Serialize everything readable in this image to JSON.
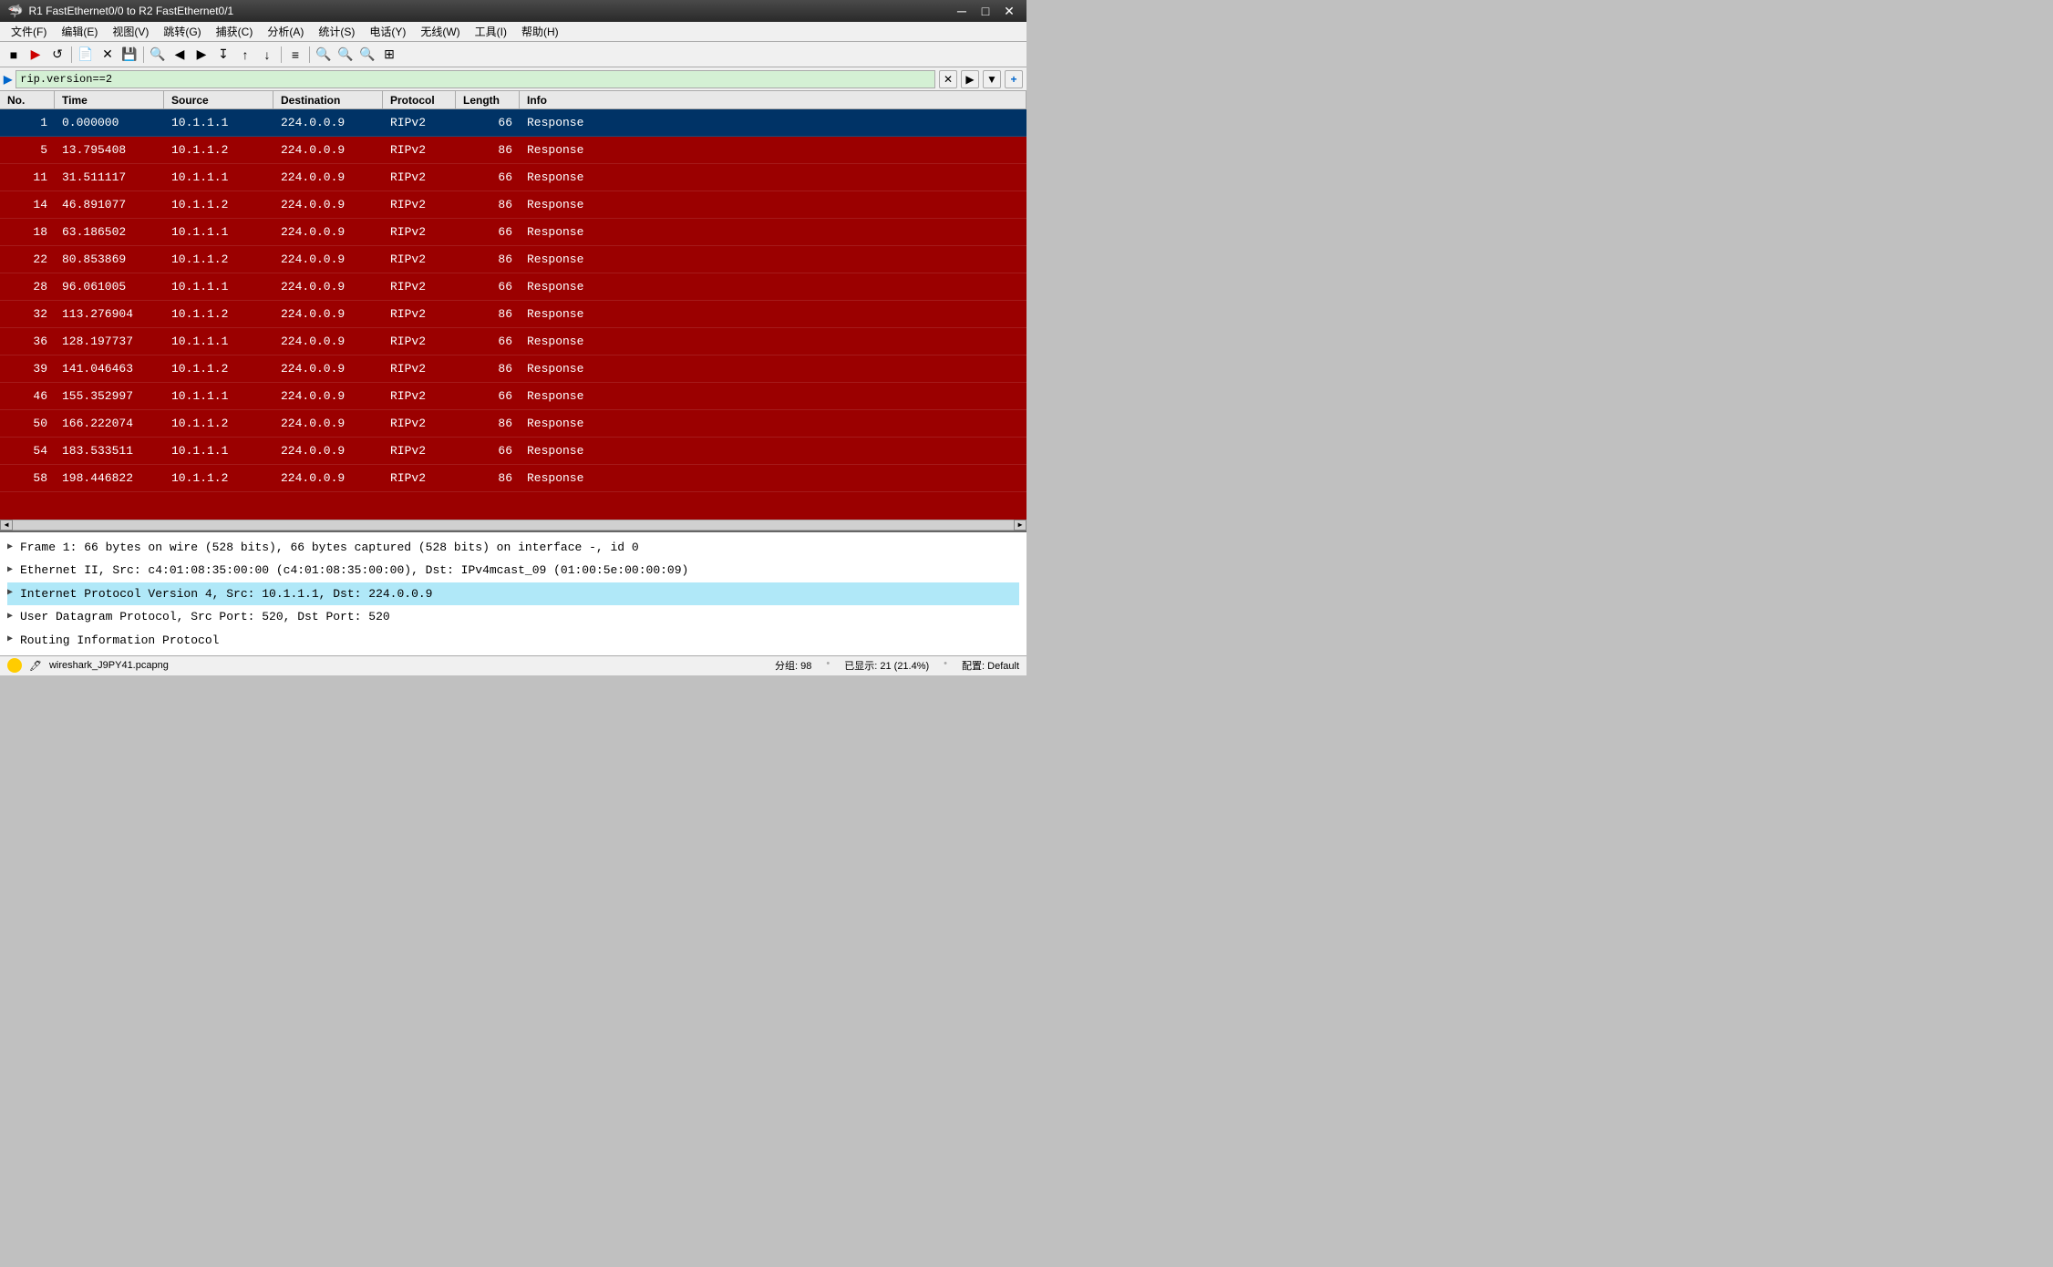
{
  "window": {
    "title": "R1 FastEthernet0/0 to R2 FastEthernet0/1",
    "icon": "🦈"
  },
  "menu": {
    "items": [
      {
        "label": "文件(F)"
      },
      {
        "label": "编辑(E)"
      },
      {
        "label": "视图(V)"
      },
      {
        "label": "跳转(G)"
      },
      {
        "label": "捕获(C)"
      },
      {
        "label": "分析(A)"
      },
      {
        "label": "统计(S)"
      },
      {
        "label": "电话(Y)"
      },
      {
        "label": "无线(W)"
      },
      {
        "label": "工具(I)"
      },
      {
        "label": "帮助(H)"
      }
    ]
  },
  "filter": {
    "value": "rip.version==2",
    "label": ""
  },
  "columns": {
    "no": "No.",
    "time": "Time",
    "source": "Source",
    "destination": "Destination",
    "protocol": "Protocol",
    "length": "Length",
    "info": "Info"
  },
  "packets": [
    {
      "no": "1",
      "time": "0.000000",
      "src": "10.1.1.1",
      "dst": "224.0.0.9",
      "proto": "RIPv2",
      "len": "66",
      "info": "Response"
    },
    {
      "no": "5",
      "time": "13.795408",
      "src": "10.1.1.2",
      "dst": "224.0.0.9",
      "proto": "RIPv2",
      "len": "86",
      "info": "Response"
    },
    {
      "no": "11",
      "time": "31.511117",
      "src": "10.1.1.1",
      "dst": "224.0.0.9",
      "proto": "RIPv2",
      "len": "66",
      "info": "Response"
    },
    {
      "no": "14",
      "time": "46.891077",
      "src": "10.1.1.2",
      "dst": "224.0.0.9",
      "proto": "RIPv2",
      "len": "86",
      "info": "Response"
    },
    {
      "no": "18",
      "time": "63.186502",
      "src": "10.1.1.1",
      "dst": "224.0.0.9",
      "proto": "RIPv2",
      "len": "66",
      "info": "Response"
    },
    {
      "no": "22",
      "time": "80.853869",
      "src": "10.1.1.2",
      "dst": "224.0.0.9",
      "proto": "RIPv2",
      "len": "86",
      "info": "Response"
    },
    {
      "no": "28",
      "time": "96.061005",
      "src": "10.1.1.1",
      "dst": "224.0.0.9",
      "proto": "RIPv2",
      "len": "66",
      "info": "Response"
    },
    {
      "no": "32",
      "time": "113.276904",
      "src": "10.1.1.2",
      "dst": "224.0.0.9",
      "proto": "RIPv2",
      "len": "86",
      "info": "Response"
    },
    {
      "no": "36",
      "time": "128.197737",
      "src": "10.1.1.1",
      "dst": "224.0.0.9",
      "proto": "RIPv2",
      "len": "66",
      "info": "Response"
    },
    {
      "no": "39",
      "time": "141.046463",
      "src": "10.1.1.2",
      "dst": "224.0.0.9",
      "proto": "RIPv2",
      "len": "86",
      "info": "Response"
    },
    {
      "no": "46",
      "time": "155.352997",
      "src": "10.1.1.1",
      "dst": "224.0.0.9",
      "proto": "RIPv2",
      "len": "66",
      "info": "Response"
    },
    {
      "no": "50",
      "time": "166.222074",
      "src": "10.1.1.2",
      "dst": "224.0.0.9",
      "proto": "RIPv2",
      "len": "86",
      "info": "Response"
    },
    {
      "no": "54",
      "time": "183.533511",
      "src": "10.1.1.1",
      "dst": "224.0.0.9",
      "proto": "RIPv2",
      "len": "66",
      "info": "Response"
    },
    {
      "no": "58",
      "time": "198.446822",
      "src": "10.1.1.2",
      "dst": "224.0.0.9",
      "proto": "RIPv2",
      "len": "86",
      "info": "Response"
    }
  ],
  "detail": {
    "rows": [
      {
        "id": "frame",
        "expanded": false,
        "text": "Frame 1: 66 bytes on wire (528 bits), 66 bytes captured (528 bits) on interface -, id 0",
        "highlighted": false
      },
      {
        "id": "ethernet",
        "expanded": false,
        "text": "Ethernet II, Src: c4:01:08:35:00:00 (c4:01:08:35:00:00), Dst: IPv4mcast_09 (01:00:5e:00:00:09)",
        "highlighted": false
      },
      {
        "id": "ip",
        "expanded": false,
        "text": "Internet Protocol Version 4, Src: 10.1.1.1, Dst: 224.0.0.9",
        "highlighted": true
      },
      {
        "id": "udp",
        "expanded": false,
        "text": "User Datagram Protocol, Src Port: 520, Dst Port: 520",
        "highlighted": false
      },
      {
        "id": "rip",
        "expanded": false,
        "text": "Routing Information Protocol",
        "highlighted": false
      }
    ]
  },
  "status": {
    "filename": "wireshark_J9PY41.pcapng",
    "groups": "分组: 98",
    "displayed": "已显示: 21 (21.4%)",
    "config": "配置: Default"
  },
  "toolbar_buttons": [
    "■",
    "▶",
    "↺",
    "⊟",
    "✕",
    "↺",
    "🔍",
    "◀",
    "▶",
    "↧",
    "↑",
    "↓",
    "≡",
    "▣",
    "🔍+",
    "🔍-",
    "🔍×",
    "⊞"
  ],
  "colors": {
    "packet_bg": "#9b0000",
    "packet_text": "#ffffff",
    "selected_bg": "#003366",
    "highlight_bg": "#b0e8f8",
    "filter_bg": "#d4f0d4"
  }
}
